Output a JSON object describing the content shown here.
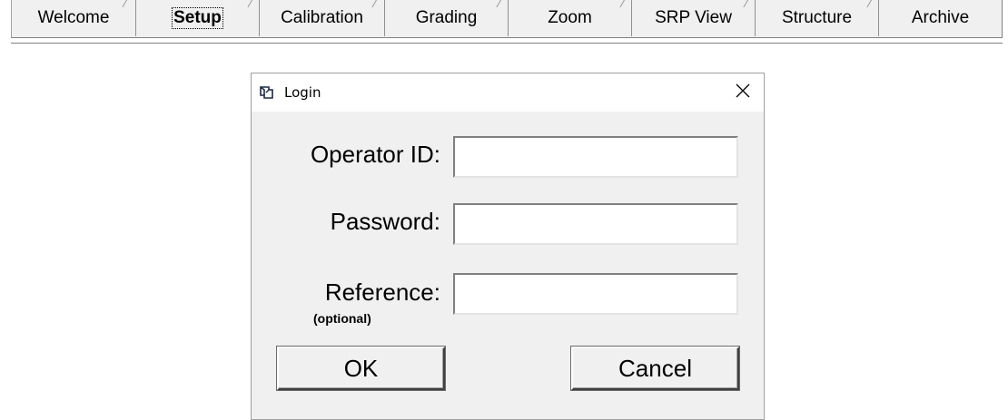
{
  "tabs": [
    {
      "label": "Welcome",
      "selected": false
    },
    {
      "label": "Setup",
      "selected": true
    },
    {
      "label": "Calibration",
      "selected": false
    },
    {
      "label": "Grading",
      "selected": false
    },
    {
      "label": "Zoom",
      "selected": false
    },
    {
      "label": "SRP View",
      "selected": false
    },
    {
      "label": "Structure",
      "selected": false
    },
    {
      "label": "Archive",
      "selected": false
    }
  ],
  "dialog": {
    "title": "Login",
    "title_icon": "login-window-icon",
    "close_icon": "close-icon",
    "fields": {
      "operator_id": {
        "label": "Operator ID:",
        "value": ""
      },
      "password": {
        "label": "Password:",
        "value": ""
      },
      "reference": {
        "label": "Reference:",
        "sublabel": "(optional)",
        "value": ""
      }
    },
    "ok_label": "OK",
    "cancel_label": "Cancel"
  },
  "colors": {
    "window_background": "#f0f0f0",
    "titlebar_background": "#ffffff",
    "input_background": "#ffffff"
  }
}
